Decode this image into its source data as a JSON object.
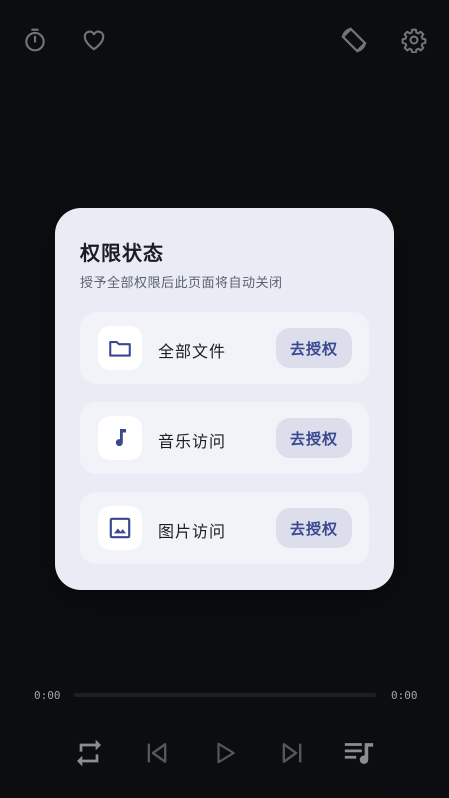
{
  "topbar": {
    "icons": [
      "timer-icon",
      "heart-icon",
      "rotate-screen-icon",
      "gear-icon"
    ]
  },
  "dialog": {
    "title": "权限状态",
    "subtitle": "授予全部权限后此页面将自动关闭",
    "permissions": [
      {
        "label": "全部文件",
        "icon": "folder-icon",
        "button": "去授权"
      },
      {
        "label": "音乐访问",
        "icon": "music-note-icon",
        "button": "去授权"
      },
      {
        "label": "图片访问",
        "icon": "image-icon",
        "button": "去授权"
      }
    ]
  },
  "player": {
    "elapsed": "0:00",
    "duration": "0:00",
    "progress": 0,
    "controls": [
      "repeat-icon",
      "previous-icon",
      "play-icon",
      "next-icon",
      "playlist-icon"
    ]
  },
  "colors": {
    "background": "#0f1013",
    "dialog": "#e9ecf5",
    "accent": "#3a4890"
  }
}
